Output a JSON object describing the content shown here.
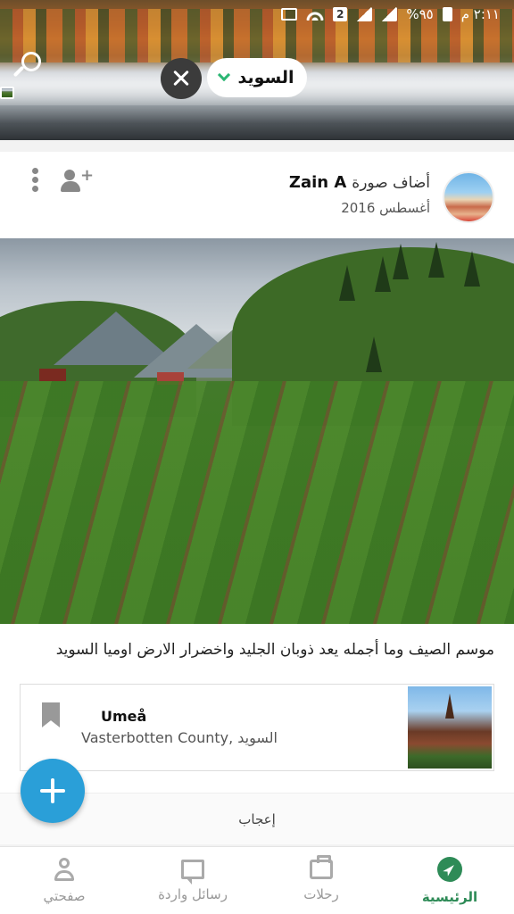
{
  "status_bar": {
    "time": "٢:١١ م",
    "battery_text": "%٩٥",
    "network_badge": "2"
  },
  "header": {
    "country_filter": "السويد",
    "icons": [
      "search-icon",
      "close-icon",
      "chevron-down-icon"
    ]
  },
  "post": {
    "user": "Zain A",
    "action": "أضاف صورة",
    "date": "أغسطس 2016",
    "caption": "موسم الصيف وما أجمله يعد ذوبان الجليد واخضرار الارض اوميا السويد",
    "place": {
      "name": "Umeå",
      "region": "Vasterbotten County, السويد"
    },
    "like_label": "إعجاب"
  },
  "bottom_nav": {
    "items": [
      {
        "label": "الرئيسية",
        "icon": "compass-icon",
        "active": true
      },
      {
        "label": "رحلات",
        "icon": "suitcase-icon",
        "active": false
      },
      {
        "label": "رسائل واردة",
        "icon": "inbox-icon",
        "active": false
      },
      {
        "label": "صفحتي",
        "icon": "profile-icon",
        "active": false
      }
    ]
  },
  "colors": {
    "accent_green": "#2e8b57",
    "fab_blue": "#2a9fd8",
    "chevron_green": "#2bb673"
  }
}
